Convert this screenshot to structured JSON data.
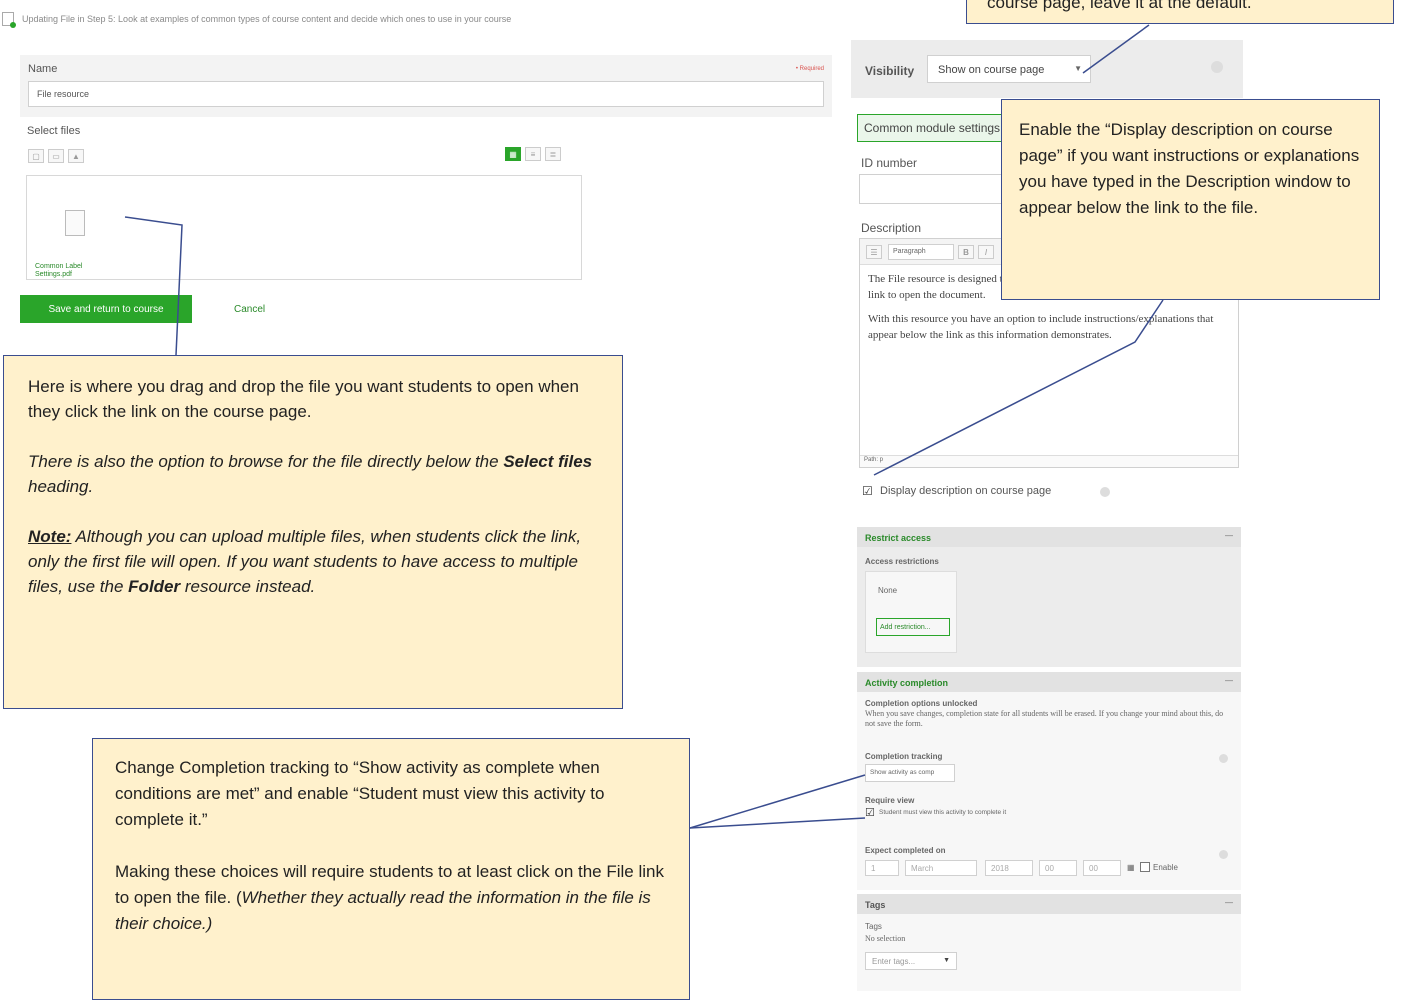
{
  "header": {
    "title": "Updating File in Step 5: Look at examples of common types of course content and decide which ones to use in your course"
  },
  "form": {
    "name_label": "Name",
    "required_label": "• Required",
    "name_value": "File resource",
    "select_files_label": "Select files",
    "file_name": "Common Label Settings.pdf",
    "save_label": "Save and return to course",
    "cancel_label": "Cancel"
  },
  "settings": {
    "visibility_label": "Visibility",
    "visibility_value": "Show on course page",
    "common_module_label": "Common module settings",
    "id_number_label": "ID number",
    "description_label": "Description",
    "editor_style": "Paragraph",
    "description_p1": "The File resource is designed to link to a file on your computer. Students click the link to open the document.",
    "description_p2": "With this resource you have an option to include instructions/explanations that appear below the link as this information demonstrates.",
    "path_label": "Path: p",
    "display_description_label": "Display description on course page"
  },
  "restrict": {
    "header": "Restrict access",
    "access_label": "Access restrictions",
    "none_label": "None",
    "add_restriction_label": "Add restriction..."
  },
  "completion": {
    "header": "Activity completion",
    "unlocked_title": "Completion options unlocked",
    "unlocked_text": "When you save changes, completion state for all students will be erased. If you change your mind about this, do not save the form.",
    "tracking_label": "Completion tracking",
    "tracking_value": "Show activity as comp",
    "require_view_label": "Require view",
    "require_view_text": "Student must view this activity to complete it",
    "expect_label": "Expect completed on",
    "day": "1",
    "month": "March",
    "year": "2018",
    "hour": "00",
    "minute": "00",
    "enable_label": "Enable"
  },
  "tags": {
    "header": "Tags",
    "label": "Tags",
    "no_selection": "No selection",
    "placeholder": "Enter tags..."
  },
  "callouts": {
    "top": "course page, leave it at the default.",
    "display_desc": "Enable the “Display description on course page” if you want instructions or explanations you have typed in the Description window to appear below the link to the file.",
    "drag_p1": "Here is where you drag and drop the file you want students to open when they click the link on the course page.",
    "drag_p2_a": "There is also the option to browse for the file directly below the ",
    "drag_p2_bold": "Select files",
    "drag_p2_b": " heading.",
    "drag_note_label": "Note:",
    "drag_p3_a": " Although you can upload multiple files, when students click the link, only the first file will open. If you want students to have access to multiple files, use the ",
    "drag_p3_bold": "Folder",
    "drag_p3_b": " resource instead.",
    "completion_p1": "Change Completion tracking to “Show activity as complete when conditions are met” and enable “Student must view this activity to complete it.”",
    "completion_p2_a": "Making these choices will require students to at least click on the File link to open the file. (",
    "completion_p2_i": "Whether they actually read the information in the file is their choice.)"
  },
  "colors": {
    "callout_bg": "#fff1cc",
    "callout_border": "#3a4d8f",
    "accent_green": "#2aa52a"
  }
}
